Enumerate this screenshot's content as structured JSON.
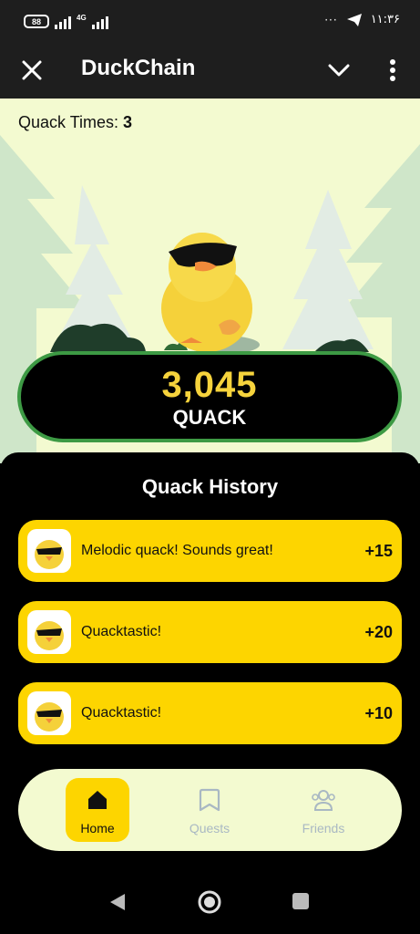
{
  "status_bar": {
    "battery": "88",
    "network": "4G",
    "dots": "···",
    "time": "۱۱:۳۶",
    "icons": [
      "battery-icon",
      "signal-icon",
      "telegram-send-icon"
    ]
  },
  "header": {
    "title": "DuckChain",
    "icons": [
      "close-icon",
      "chevron-down-icon",
      "more-vertical-icon"
    ]
  },
  "game": {
    "quack_times_label": "Quack Times:",
    "quack_times_value": "3",
    "score": "3,045",
    "score_unit": "QUACK"
  },
  "history": {
    "title": "Quack History",
    "items": [
      {
        "text": "Melodic quack! Sounds great!",
        "points": "+15"
      },
      {
        "text": "Quacktastic!",
        "points": "+20"
      },
      {
        "text": "Quacktastic!",
        "points": "+10"
      }
    ]
  },
  "nav": {
    "items": [
      {
        "label": "Home",
        "icon": "home-icon",
        "active": true
      },
      {
        "label": "Quests",
        "icon": "bookmark-icon",
        "active": false
      },
      {
        "label": "Friends",
        "icon": "friends-icon",
        "active": false
      }
    ]
  },
  "colors": {
    "accent_yellow": "#fdd500",
    "score_yellow": "#f6d33c",
    "scene_bg": "#f3fad0",
    "pill_border": "#3d9a44",
    "header_bg": "#1e1e1e",
    "inactive_nav": "#a9b8c3"
  }
}
